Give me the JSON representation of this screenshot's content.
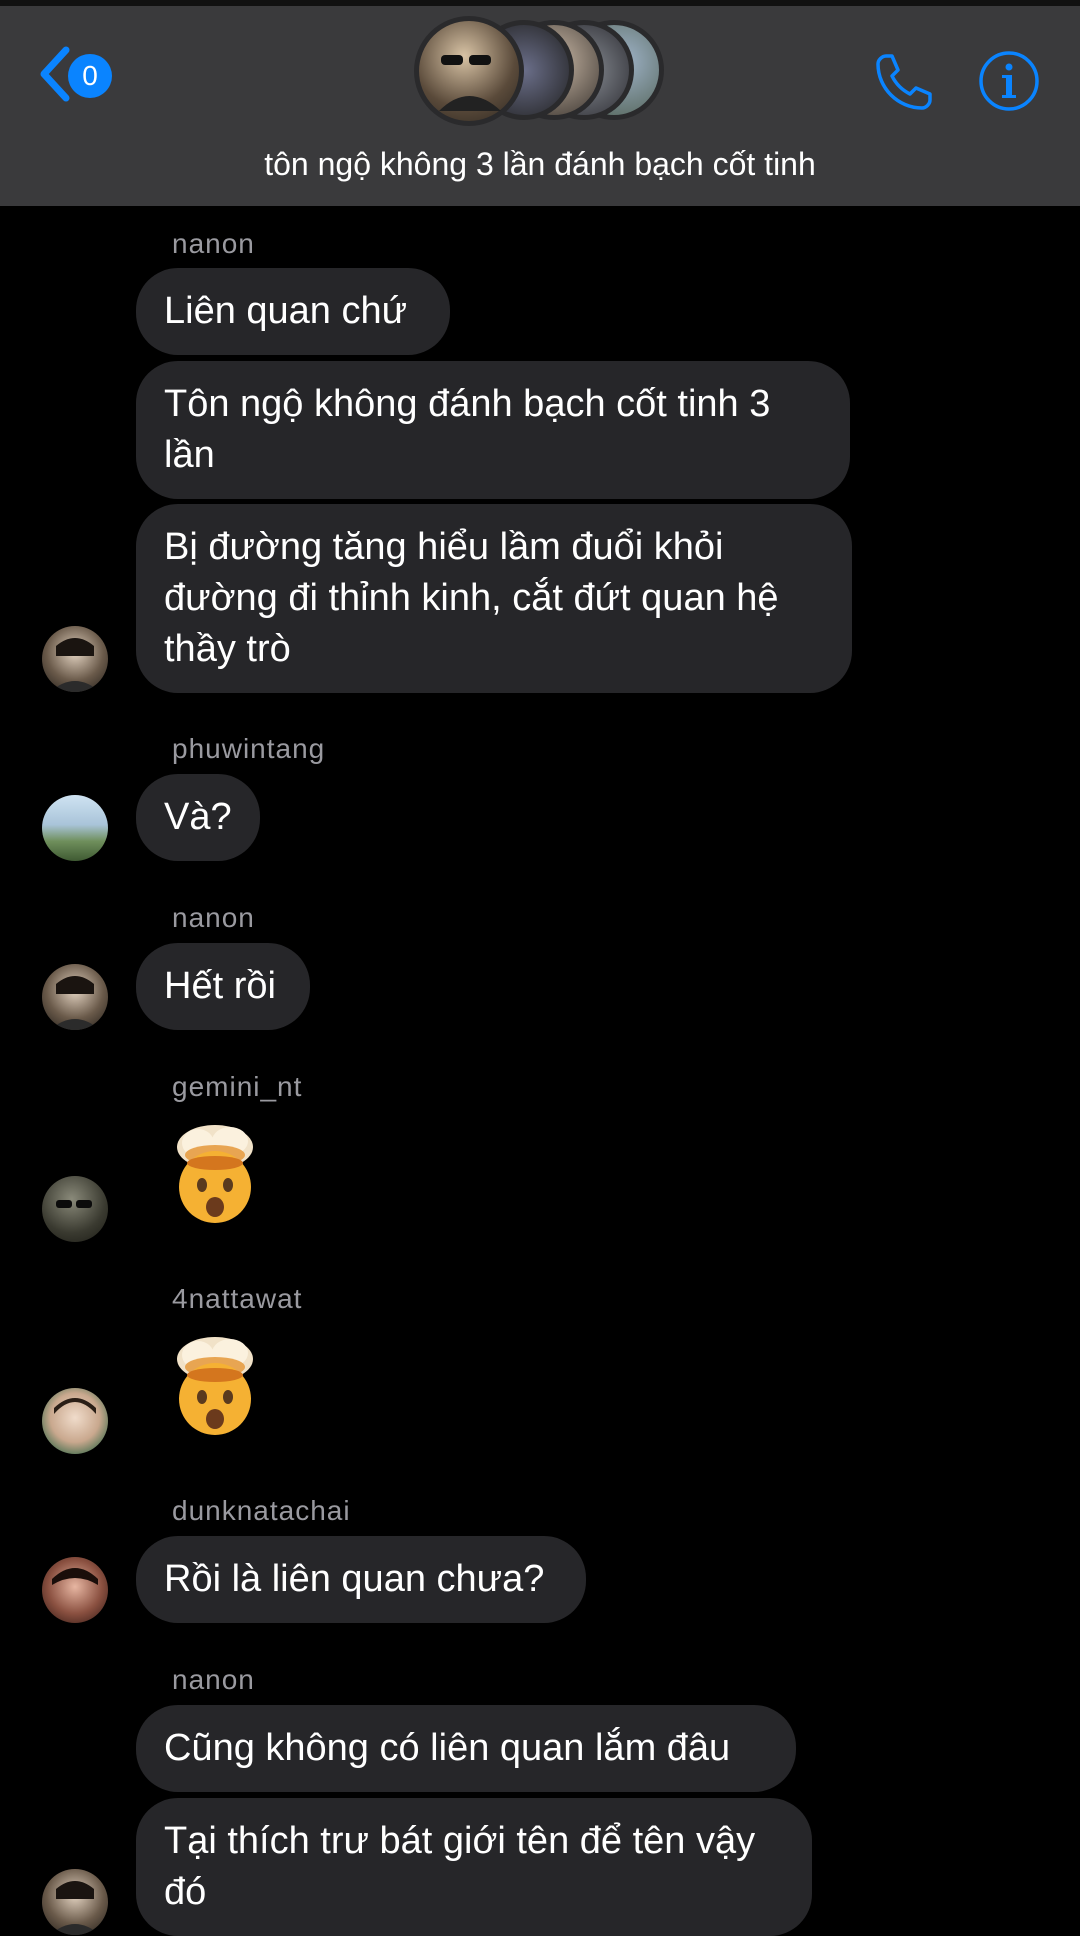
{
  "header": {
    "badge_count": "0",
    "group_name": "tôn ngộ không 3 lần đánh bạch cốt tinh"
  },
  "icons": {
    "back": "chevron-left-icon",
    "call": "phone-icon",
    "info": "info-icon"
  },
  "colors": {
    "accent": "#0a84ff",
    "bubble": "#262629",
    "header_bg": "#3a3a3c",
    "sender_text": "#9a9aa0"
  },
  "messages": [
    {
      "sender": "nanon",
      "bubbles": [
        "Liên quan chứ",
        "Tôn ngộ không đánh bạch cốt tinh 3 lần",
        "Bị đường tăng hiểu lầm đuổi khỏi đường đi thỉnh kinh, cắt đứt quan hệ thầy trò"
      ]
    },
    {
      "sender": "phuwintang",
      "bubbles": [
        "Và?"
      ]
    },
    {
      "sender": "nanon",
      "bubbles": [
        "Hết rồi"
      ]
    },
    {
      "sender": "gemini_nt",
      "emoji": "exploding-head-emoji"
    },
    {
      "sender": "4nattawat",
      "emoji": "exploding-head-emoji"
    },
    {
      "sender": "dunknatachai",
      "bubbles": [
        "Rồi là liên quan chưa?"
      ]
    },
    {
      "sender": "nanon",
      "bubbles": [
        "Cũng không có liên quan lắm đâu",
        "Tại thích trư bát giới tên để tên vậy đó"
      ]
    }
  ]
}
